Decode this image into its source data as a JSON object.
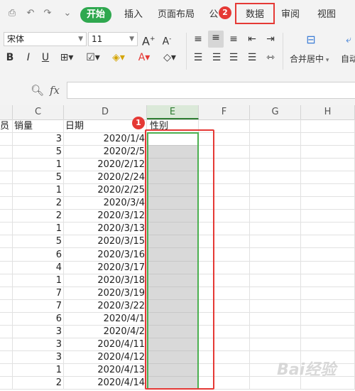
{
  "menubar": {
    "tabs": [
      "开始",
      "插入",
      "页面布局",
      "公",
      "数据",
      "审阅",
      "视图"
    ],
    "badge_data": "2"
  },
  "ribbon": {
    "font_name": "宋体",
    "font_size": "11",
    "merge_label": "合并居中",
    "auto_label": "自动"
  },
  "formula_bar": {
    "fx_label": "fx"
  },
  "grid": {
    "columns": [
      "员",
      "C",
      "D",
      "E",
      "F",
      "G",
      "H"
    ],
    "header_row": {
      "B": "员",
      "C": "销量",
      "D": "日期",
      "E": "性别"
    },
    "badge_e": "1",
    "sales": [
      "3",
      "5",
      "1",
      "5",
      "1",
      "2",
      "2",
      "1",
      "5",
      "6",
      "4",
      "1",
      "7",
      "7",
      "6",
      "3",
      "3",
      "3",
      "1",
      "2"
    ],
    "dates": [
      "2020/1/4",
      "2020/2/5",
      "2020/2/12",
      "2020/2/24",
      "2020/2/25",
      "2020/3/4",
      "2020/3/12",
      "2020/3/13",
      "2020/3/15",
      "2020/3/16",
      "2020/3/17",
      "2020/3/18",
      "2020/3/19",
      "2020/3/22",
      "2020/4/1",
      "2020/4/2",
      "2020/4/11",
      "2020/4/12",
      "2020/4/13",
      "2020/4/14"
    ]
  },
  "watermark": "Bai经验"
}
